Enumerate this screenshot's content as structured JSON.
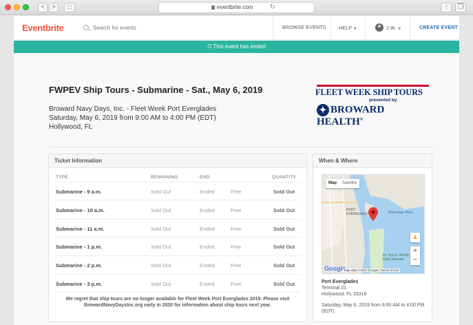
{
  "browser": {
    "url": "eventbrite.com",
    "back": "<",
    "forward": ">",
    "sidebar": "□",
    "reload": "↻"
  },
  "nav": {
    "logo": "Eventbrite",
    "search_placeholder": "Search for events",
    "browse": "BROWSE EVENTS",
    "help": "HELP",
    "help_chevron": "∨",
    "user": "J.W.",
    "user_chevron": "∨",
    "create": "CREATE EVENT"
  },
  "banner": {
    "icon": "⏱",
    "text": "This event has ended"
  },
  "event": {
    "title": "FWPEV Ship Tours - Submarine - Sat., May 6, 2019",
    "organizer": "Broward Navy Days, Inc. - Fleet Week Port Everglades",
    "datetime": "Saturday, May 6, 2019 from 9:00 AM to 4:00 PM (EDT)",
    "location": "Hollywood, FL"
  },
  "promo": {
    "line1": "FLEET WEEK SHIP TOURS",
    "line2": "presented by",
    "line3": "BROWARD HEALTH",
    "reg": "®",
    "star": "✦"
  },
  "tickets": {
    "heading": "Ticket Information",
    "columns": {
      "type": "TYPE",
      "remaining": "REMAINING",
      "end": "END",
      "quantity": "QUANTITY"
    },
    "rows": [
      {
        "type": "Submarine - 9 a.m.",
        "remaining": "Sold Out",
        "end": "Ended",
        "price": "Free",
        "quantity": "Sold Out"
      },
      {
        "type": "Submarine - 10 a.m.",
        "remaining": "Sold Out",
        "end": "Ended",
        "price": "Free",
        "quantity": "Sold Out"
      },
      {
        "type": "Submarine - 11 a.m.",
        "remaining": "Sold Out",
        "end": "Ended",
        "price": "Free",
        "quantity": "Sold Out"
      },
      {
        "type": "Submarine - 1 p.m.",
        "remaining": "Sold Out",
        "end": "Ended",
        "price": "Free",
        "quantity": "Sold Out"
      },
      {
        "type": "Submarine - 2 p.m.",
        "remaining": "Sold Out",
        "end": "Ended",
        "price": "Free",
        "quantity": "Sold Out"
      },
      {
        "type": "Submarine - 3 p.m.",
        "remaining": "Sold Out",
        "end": "Ended",
        "price": "Free",
        "quantity": "Sold Out"
      }
    ],
    "note": "We regret that ship tours are no longer available for Fleet Week Port Everglades 2019. Please visit BrowardNavyDaysInc.org early in 2020 for information about ship tours next year."
  },
  "where": {
    "heading": "When & Where",
    "map_tab": "Map",
    "satellite_tab": "Satellite",
    "map_label_port": "PORT EVERGLADES",
    "map_label_river": "Stranahan River",
    "map_label_park": "Dr. Von D. Mizell-Eula Johnson",
    "map_google": "Google",
    "map_credit": "Map data ©2017 Google | Terms of Use",
    "zoom_in": "+",
    "zoom_out": "−",
    "pegman": "♟",
    "venue": "Port Everglades",
    "address1": "Terminal 21",
    "address2": "Hollywood, FL 33316",
    "when": "Saturday, May 6, 2019 from 9:00 AM to 4:00 PM (EDT)"
  }
}
